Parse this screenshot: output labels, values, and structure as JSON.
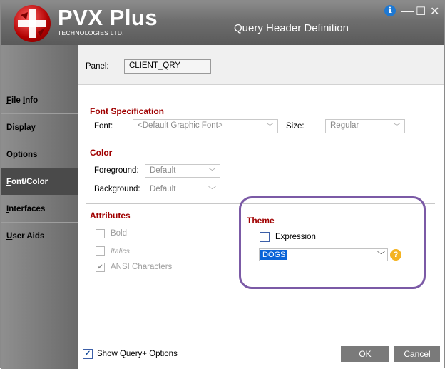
{
  "window": {
    "brand": "PVX Plus",
    "brand_sub": "TECHNOLOGIES LTD.",
    "title": "Query Header Definition",
    "controls": {
      "info": "i",
      "minimize": "—",
      "maximize": "☐",
      "close": "✕"
    }
  },
  "sidebar": {
    "items": [
      {
        "label_underlined": "F",
        "label_rest": "ile ",
        "label_underlined2": "I",
        "label_rest2": "nfo"
      },
      {
        "label_underlined": "D",
        "label_rest": "isplay"
      },
      {
        "label_underlined": "O",
        "label_rest": "ptions"
      },
      {
        "label_underlined": "F",
        "label_rest": "ont/Color",
        "active": true
      },
      {
        "label_underlined": "I",
        "label_rest": "nterfaces"
      },
      {
        "label_underlined": "U",
        "label_rest": "ser Aids"
      }
    ]
  },
  "panel": {
    "label": "Panel:",
    "value": "CLIENT_QRY"
  },
  "font_spec": {
    "heading": "Font Specification",
    "font_label": "Font:",
    "font_value": "<Default Graphic Font>",
    "size_label": "Size:",
    "size_value": "Regular"
  },
  "color": {
    "heading": "Color",
    "foreground_label": "Foreground:",
    "foreground_value": "Default",
    "background_label": "Background:",
    "background_value": "Default"
  },
  "attributes": {
    "heading": "Attributes",
    "bold": "Bold",
    "italics": "Italics",
    "ansi": "ANSI Characters",
    "ansi_check": "✔"
  },
  "theme": {
    "heading": "Theme",
    "expression": "Expression",
    "value": "DOGS",
    "help_icon": "?"
  },
  "footer": {
    "show_query_label": "Show Query+ Options",
    "show_query_check": "✔",
    "ok": "OK",
    "cancel": "Cancel"
  },
  "colors": {
    "section_heading": "#a00000",
    "highlight_outline": "#7b5aa6",
    "selection": "#0a64d8"
  }
}
